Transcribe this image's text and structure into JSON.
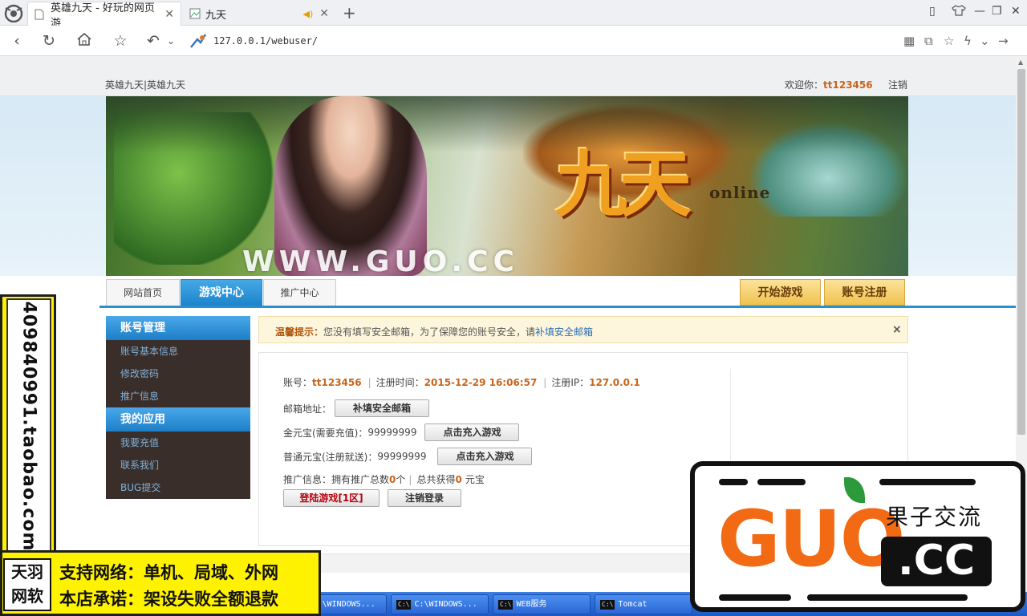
{
  "browser": {
    "tabs": [
      {
        "title": "英雄九天 - 好玩的网页游",
        "close": "✕"
      },
      {
        "title": "九天",
        "close": "✕"
      }
    ],
    "new_tab": "+",
    "url": "127.0.0.1/webuser/"
  },
  "header": {
    "site_name": "英雄九天|英雄九天",
    "welcome_label": "欢迎你：",
    "username": "tt123456",
    "logout": "注销"
  },
  "banner": {
    "game_logo": "九天",
    "game_sub": "online",
    "watermark": "WWW.GUO.CC"
  },
  "nav": {
    "tabs": [
      "网站首页",
      "游戏中心",
      "推广中心"
    ],
    "start_game": "开始游戏",
    "register": "账号注册"
  },
  "sidebar": {
    "groups": [
      {
        "title": "账号管理",
        "items": [
          "账号基本信息",
          "修改密码",
          "推广信息"
        ]
      },
      {
        "title": "我的应用",
        "items": [
          "我要充值",
          "联系我们",
          "BUG提交"
        ]
      }
    ]
  },
  "notice": {
    "label": "温馨提示：",
    "text": "您没有填写安全邮箱，为了保障您的账号安全，请",
    "link": "补填安全邮箱",
    "close": "×"
  },
  "account": {
    "account_label": "账号：",
    "account_value": "tt123456",
    "reg_time_label": "注册时间：",
    "reg_time_value": "2015-12-29 16:06:57",
    "reg_ip_label": "注册IP：",
    "reg_ip_value": "127.0.0.1",
    "email_label": "邮箱地址：",
    "email_button": "补填安全邮箱",
    "gold_label": "金元宝(需要充值)：",
    "gold_value": "99999999",
    "gold_button": "点击充入游戏",
    "normal_label": "普通元宝(注册就送)：",
    "normal_value": "99999999",
    "normal_button": "点击充入游戏",
    "promo_prefix": "推广信息：拥有推广总数",
    "promo_count": "0",
    "promo_unit": "个",
    "promo_mid": "总共获得",
    "promo_earned": "0",
    "promo_suffix": "元宝",
    "login_game_button": "登陆游戏[1区]",
    "logout_button": "注销登录"
  },
  "taskbar": {
    "items": [
      "C:\\WINDOWS...",
      "C:\\WINDOWS...",
      "WEB服务",
      "Tomcat"
    ],
    "cmd_badge": "C:\\"
  },
  "overlays": {
    "vertical_text": "409840991.taobao.com",
    "badge_line1": "天羽",
    "badge_line2": "网软",
    "line1": "支持网络：单机、局域、外网",
    "line2": "本店承诺：架设失败全额退款",
    "guo_big": "GUO",
    "guo_cn": "果子交流",
    "guo_cc": ".CC"
  }
}
